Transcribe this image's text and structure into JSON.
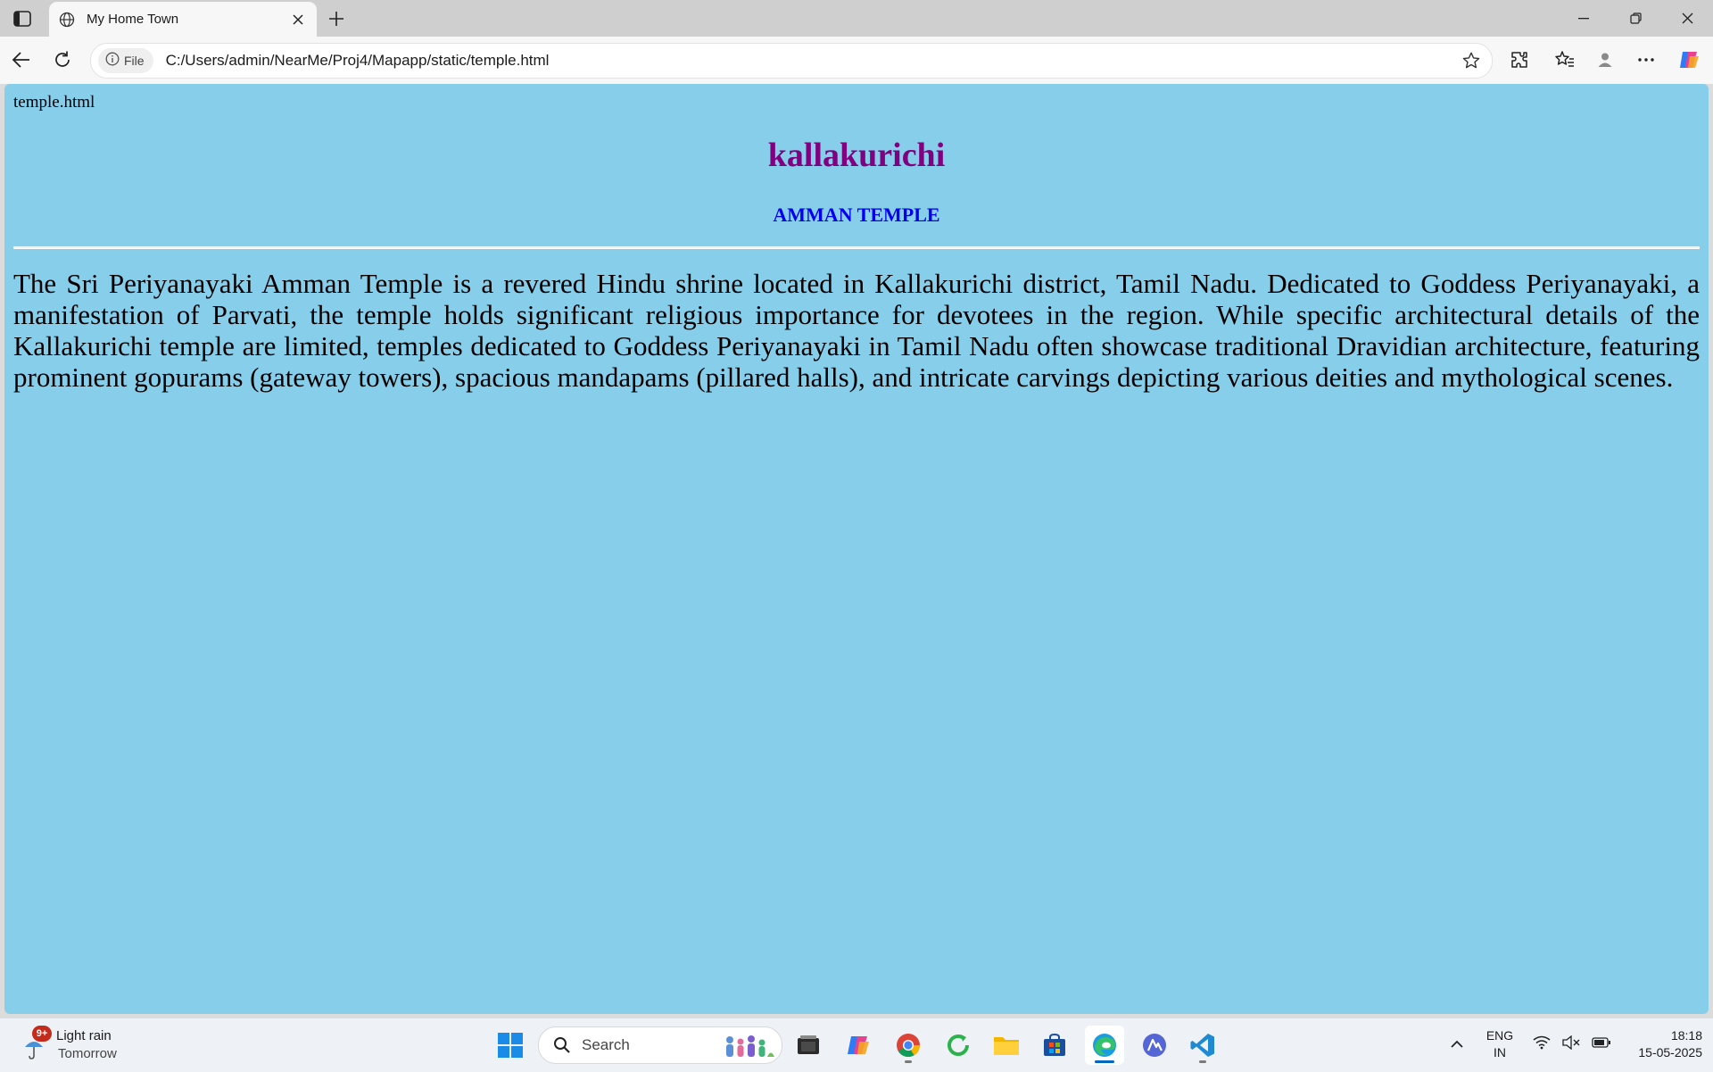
{
  "browser": {
    "tab_title": "My Home Town",
    "address": {
      "site_info_label": "File",
      "url": "C:/Users/admin/NearMe/Proj4/Mapapp/static/temple.html"
    }
  },
  "page": {
    "file_label": "temple.html",
    "heading": "kallakurichi",
    "subheading": "AMMAN TEMPLE",
    "paragraph": "The Sri Periyanayaki Amman Temple is a revered Hindu shrine located in Kallakurichi district, Tamil Nadu. Dedicated to Goddess Periyanayaki, a manifestation of Parvati, the temple holds significant religious importance for devotees in the region. While specific architectural details of the Kallakurichi temple are limited, temples dedicated to Goddess Periyanayaki in Tamil Nadu often showcase traditional Dravidian architecture, featuring prominent gopurams (gateway towers), spacious mandapams (pillared halls), and intricate carvings depicting various deities and mythological scenes.",
    "colors": {
      "background": "#87ceeb",
      "heading": "#800080",
      "subheading": "#0000ee"
    }
  },
  "taskbar": {
    "weather": {
      "badge": "9+",
      "condition": "Light rain",
      "when": "Tomorrow"
    },
    "search_label": "Search",
    "apps": [
      "task-view",
      "copilot",
      "chrome",
      "cycle-app",
      "file-explorer",
      "microsoft-store",
      "edge",
      "ai-app",
      "vs-code"
    ],
    "language": {
      "line1": "ENG",
      "line2": "IN"
    },
    "clock": {
      "time": "18:18",
      "date": "15-05-2025"
    }
  }
}
